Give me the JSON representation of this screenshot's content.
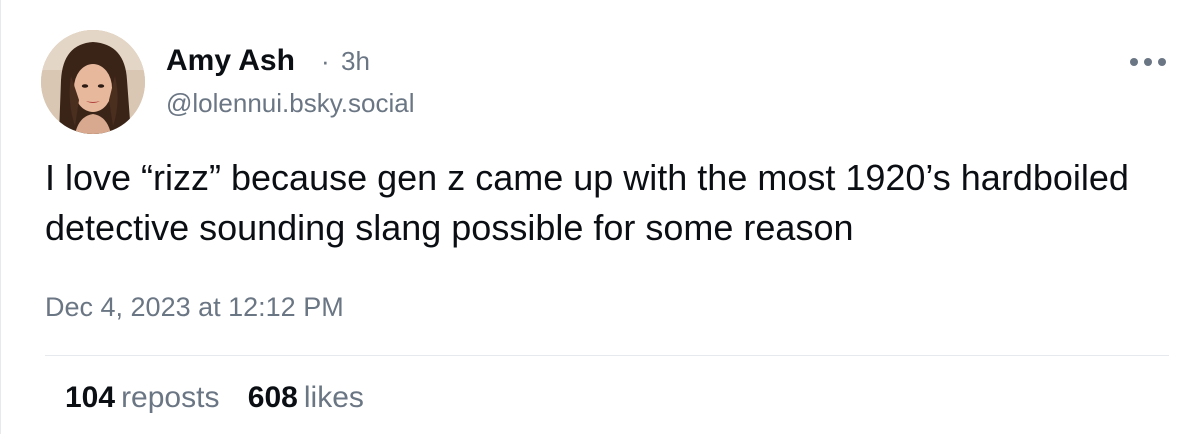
{
  "post": {
    "author": {
      "display_name": "Amy Ash",
      "handle": "@lolennui.bsky.social",
      "time_ago": "3h",
      "separator": "·"
    },
    "text": "I love “rizz” because gen z came up with the most 1920’s hardboiled detective sounding slang possible for some reason",
    "timestamp": "Dec 4, 2023 at 12:12 PM",
    "stats": {
      "reposts_count": "104",
      "reposts_label": "reposts",
      "likes_count": "608",
      "likes_label": "likes"
    }
  },
  "icons": {
    "more": "more-horizontal-icon"
  },
  "colors": {
    "text_primary": "#0b0f14",
    "text_secondary": "#6b7684",
    "divider": "#e6e9ee"
  }
}
